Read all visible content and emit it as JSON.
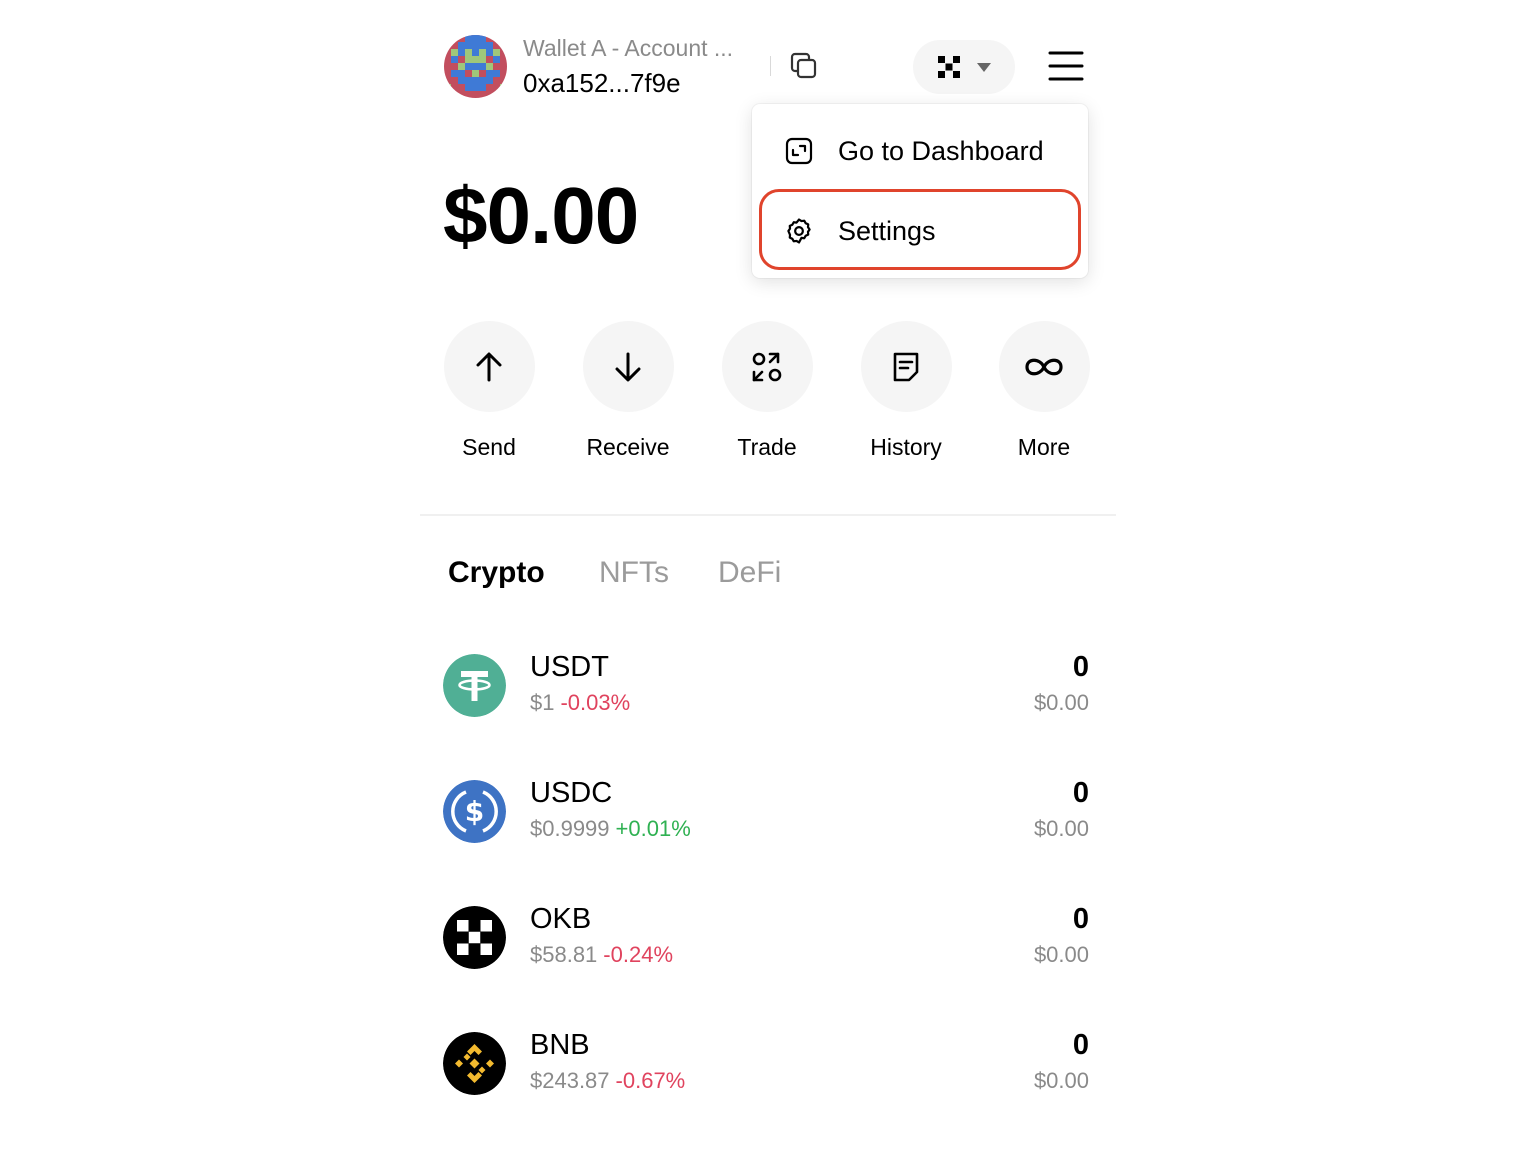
{
  "header": {
    "wallet_name": "Wallet A - Account ...",
    "address": "0xa152...7f9e"
  },
  "balance": "$0.00",
  "menu": {
    "items": [
      {
        "label": "Go to Dashboard",
        "icon": "dashboard-icon"
      },
      {
        "label": "Settings",
        "icon": "gear-icon"
      }
    ]
  },
  "actions": [
    {
      "label": "Send",
      "icon": "arrow-up-icon"
    },
    {
      "label": "Receive",
      "icon": "arrow-down-icon"
    },
    {
      "label": "Trade",
      "icon": "swap-icon"
    },
    {
      "label": "History",
      "icon": "document-icon"
    },
    {
      "label": "More",
      "icon": "infinity-icon"
    }
  ],
  "tabs": [
    {
      "label": "Crypto",
      "active": true
    },
    {
      "label": "NFTs",
      "active": false
    },
    {
      "label": "DeFi",
      "active": false
    }
  ],
  "tokens": [
    {
      "symbol": "USDT",
      "price": "$1",
      "change": "-0.03%",
      "amount": "0",
      "value": "$0.00",
      "color": "#50af95"
    },
    {
      "symbol": "USDC",
      "price": "$0.9999",
      "change": "+0.01%",
      "amount": "0",
      "value": "$0.00",
      "color": "#3e73c4"
    },
    {
      "symbol": "OKB",
      "price": "$58.81",
      "change": "-0.24%",
      "amount": "0",
      "value": "$0.00",
      "color": "#000000"
    },
    {
      "symbol": "BNB",
      "price": "$243.87",
      "change": "-0.67%",
      "amount": "0",
      "value": "$0.00",
      "color": "#f3ba2f"
    }
  ],
  "colors": {
    "highlight": "#e0442c",
    "negative": "#e0435e",
    "positive": "#2fb152"
  }
}
